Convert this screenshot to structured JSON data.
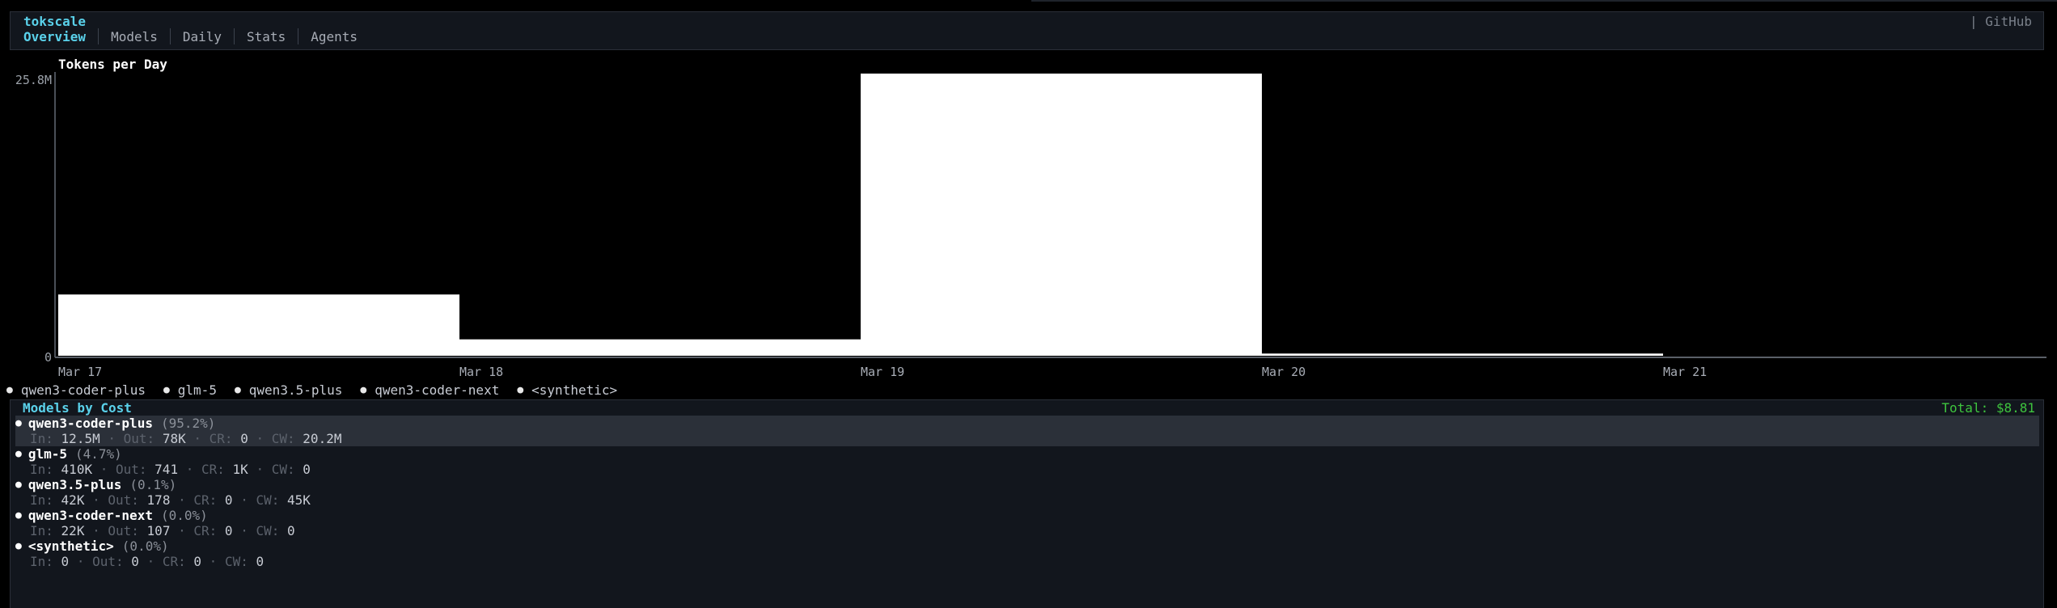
{
  "app": {
    "name": "tokscale",
    "github_label": "| GitHub"
  },
  "tabs": [
    {
      "label": "Overview",
      "active": true
    },
    {
      "label": "Models",
      "active": false
    },
    {
      "label": "Daily",
      "active": false
    },
    {
      "label": "Stats",
      "active": false
    },
    {
      "label": "Agents",
      "active": false
    }
  ],
  "chart_data": {
    "type": "bar",
    "title": "Tokens per Day",
    "categories": [
      "Mar 17",
      "Mar 18",
      "Mar 19",
      "Mar 20",
      "Mar 21"
    ],
    "values": [
      5600000,
      1500000,
      25800000,
      200000,
      0
    ],
    "ytick_labels": [
      "25.8M",
      "0"
    ],
    "ylim": [
      0,
      25800000
    ],
    "bar_color": "#ffffff",
    "series": [
      {
        "name": "qwen3-coder-plus"
      },
      {
        "name": "glm-5"
      },
      {
        "name": "qwen3.5-plus"
      },
      {
        "name": "qwen3-coder-next"
      },
      {
        "name": "<synthetic>"
      }
    ]
  },
  "legend": [
    "qwen3-coder-plus",
    "glm-5",
    "qwen3.5-plus",
    "qwen3-coder-next",
    "<synthetic>"
  ],
  "models_panel": {
    "title": "Models by Cost",
    "total_label": "Total: $8.81",
    "models": [
      {
        "name": "qwen3-coder-plus",
        "pct": "(95.2%)",
        "in": "12.5M",
        "out": "78K",
        "cr": "0",
        "cw": "20.2M",
        "selected": true
      },
      {
        "name": "glm-5",
        "pct": "(4.7%)",
        "in": "410K",
        "out": "741",
        "cr": "1K",
        "cw": "0",
        "selected": false
      },
      {
        "name": "qwen3.5-plus",
        "pct": "(0.1%)",
        "in": "42K",
        "out": "178",
        "cr": "0",
        "cw": "45K",
        "selected": false
      },
      {
        "name": "qwen3-coder-next",
        "pct": "(0.0%)",
        "in": "22K",
        "out": "107",
        "cr": "0",
        "cw": "0",
        "selected": false
      },
      {
        "name": "<synthetic>",
        "pct": "(0.0%)",
        "in": "0",
        "out": "0",
        "cr": "0",
        "cw": "0",
        "selected": false
      }
    ],
    "labels": {
      "in": "In:",
      "out": "Out:",
      "cr": "CR:",
      "cw": "CW:",
      "sep": "·"
    }
  },
  "colors": {
    "accent": "#5ad1ea",
    "total": "#3ec43e",
    "panel_bg": "#12161d",
    "selected_row": "#2b3039"
  }
}
